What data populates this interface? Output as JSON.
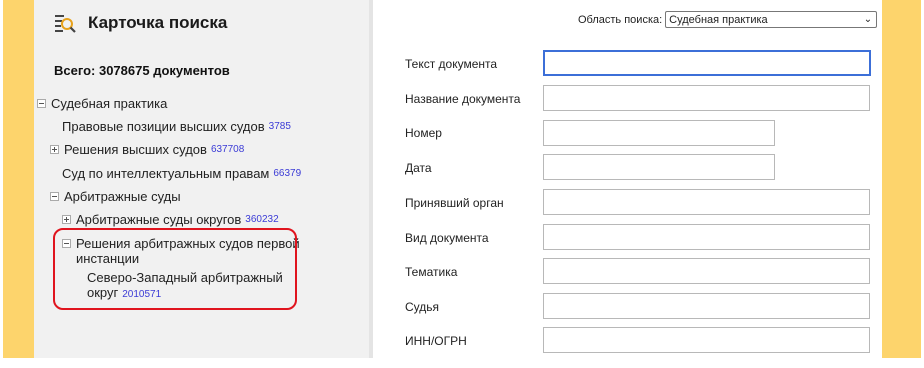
{
  "header": {
    "title": "Карточка поиска",
    "total": "Всего: 3078675 документов"
  },
  "tree": [
    {
      "label": "Судебная практика",
      "count": "",
      "toggle": "minus"
    },
    {
      "label": "Правовые позиции высших судов",
      "count": "3785",
      "toggle": ""
    },
    {
      "label": "Решения высших судов",
      "count": "637708",
      "toggle": "plus"
    },
    {
      "label": "Суд по интеллектуальным правам",
      "count": "66379",
      "toggle": ""
    },
    {
      "label": "Арбитражные суды",
      "count": "",
      "toggle": "minus"
    },
    {
      "label": "Арбитражные суды округов",
      "count": "360232",
      "toggle": "plus"
    },
    {
      "label_line1": "Решения арбитражных судов первой",
      "label_line2": "инстанции",
      "count": "",
      "toggle": "minus"
    },
    {
      "label_line1": "Северо-Западный арбитражный",
      "label_line2": "округ",
      "count": "2010571",
      "toggle": ""
    }
  ],
  "search_area": {
    "label": "Область поиска:",
    "value": "Судебная практика"
  },
  "fields": [
    {
      "label": "Текст документа",
      "value": ""
    },
    {
      "label": "Название документа",
      "value": ""
    },
    {
      "label": "Номер",
      "value": ""
    },
    {
      "label": "Дата",
      "value": ""
    },
    {
      "label": "Принявший орган",
      "value": ""
    },
    {
      "label": "Вид документа",
      "value": ""
    },
    {
      "label": "Тематика",
      "value": ""
    },
    {
      "label": "Судья",
      "value": ""
    },
    {
      "label": "ИНН/ОГРН",
      "value": ""
    }
  ],
  "colors": {
    "accent_stripe": "#fdd46c",
    "highlight": "#e0141e",
    "count": "#3b3bd6",
    "focus": "#3c6fd8"
  }
}
